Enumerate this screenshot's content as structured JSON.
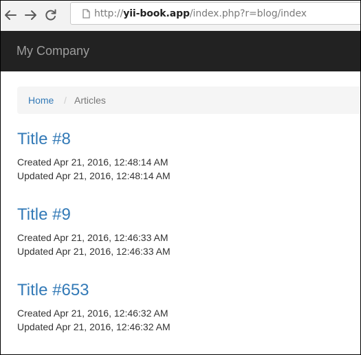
{
  "browser": {
    "url_prefix": "http://",
    "url_host": "yii-book.app",
    "url_path": "/index.php?r=blog/index",
    "icons": {
      "back": "back-arrow-icon",
      "forward": "forward-arrow-icon",
      "reload": "reload-icon",
      "page": "page-icon"
    }
  },
  "navbar": {
    "brand": "My Company"
  },
  "breadcrumb": {
    "home": "Home",
    "separator": "/",
    "current": "Articles"
  },
  "articles": [
    {
      "title": "Title #8",
      "created": "Created Apr 21, 2016, 12:48:14 AM",
      "updated": "Updated Apr 21, 2016, 12:48:14 AM"
    },
    {
      "title": "Title #9",
      "created": "Created Apr 21, 2016, 12:46:33 AM",
      "updated": "Updated Apr 21, 2016, 12:46:33 AM"
    },
    {
      "title": "Title #653",
      "created": "Created Apr 21, 2016, 12:46:32 AM",
      "updated": "Updated Apr 21, 2016, 12:46:32 AM"
    }
  ],
  "colors": {
    "navbar_bg": "#222222",
    "brand_text": "#9d9d9d",
    "link": "#337ab7",
    "breadcrumb_bg": "#f5f5f5",
    "body_text": "#333333"
  }
}
